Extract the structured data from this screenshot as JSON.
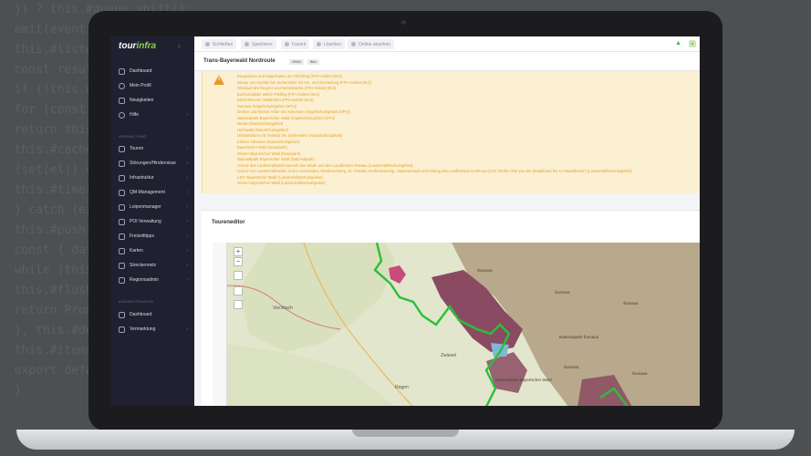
{
  "sidebar": {
    "logo_prefix": "tour",
    "logo_suffix": "infra",
    "items_top": [
      {
        "label": "Dashboard"
      },
      {
        "label": "Mein Profil"
      },
      {
        "label": "Neuigkeiten"
      },
      {
        "label": "Hilfe"
      }
    ],
    "section_verwaltung": "VERWALTUNG",
    "items_verwaltung": [
      {
        "label": "Touren"
      },
      {
        "label": "Störungen/Hindernisse"
      },
      {
        "label": "Infrastruktur"
      },
      {
        "label": "QM-Management"
      },
      {
        "label": "Loipenmanager"
      },
      {
        "label": "POI Verwaltung"
      },
      {
        "label": "Freizeittipps"
      },
      {
        "label": "Karten"
      },
      {
        "label": "Streckennetz"
      },
      {
        "label": "Regionsadmin"
      }
    ],
    "section_admin": "ADMINISTRATION",
    "items_admin": [
      {
        "label": "Dashboard"
      },
      {
        "label": "Vermarktung"
      }
    ]
  },
  "toolbar": {
    "close": "Schließen",
    "save": "Speichern",
    "favorite": "Favorit",
    "delete": "Löschen",
    "view_online": "Online ansehen"
  },
  "page": {
    "title": "Trans-Bayerwald Nordroute",
    "badge_id": "25963",
    "badge_type": "Bike"
  },
  "warning_lines": [
    "Bergwiesen und Magerrasen am Ohreberg (FFH-Gebiet (EU))",
    "Donau von Kachlet bis Jochenstein mit Inn- und Ilzmündung (FFH-Gebiet (EU))",
    "Oberlauf des Regens und Nebenbäche (FFH-Gebiet (EU))",
    "Buchenwälder östlich Pfelling (FFH-Gebiet (EU))",
    "Bischofsreuter Waldhufen (FFH-Gebiet (EU))",
    "Sumava (Vogelschutzgebiet (SPA))",
    "Großer und Kleiner Arber mit Arberseen (Vogelschutzgebiet (SPA))",
    "Nationalpark Bayerischer Wald (Vogelschutzgebiet (SPA))",
    "Mesau (Naturschutzgebiet)",
    "Hochwald (Naturschutzgebiet)",
    "Ohrwaldeben mit Trebnitz bis Jachenstein (Naturschutzgebiet)",
    "Kleiner Arbersee (Naturschutzgebiet)",
    "Bayerischer Wald (Naturpark)",
    "Oberer Bayerischer Wald (Naturpark)",
    "Nationalpark Bayerischer Wald (Nationalpark)",
    "Schutz des Landschaftsteils Bereich des Stadt- und des Landkreises Passau (Landschaftsschutzgebiet)",
    "Schutz von Landschaftsteilen in den Gemeinden Oberkreuzberg, St. Oswald, Grafenmaschig, Hammanstadt und Sirbing des Landkreises Grafenau (LSG 'Große Ohe von der Staatsforen bis zu Staatsforste') (Landschaftsschutzgebiet)",
    "LSG 'Bayerischer Wald' (Landschaftsschutzgebiet)",
    "Oberer Bayerischer Wald (Landschaftsschutzgebiet)"
  ],
  "editor": {
    "title": "Toureneditor",
    "zoom_in": "+",
    "zoom_out": "−"
  },
  "map_labels": [
    "Viechtach",
    "Zwiesel",
    "Regen",
    "Šumava",
    "Šumava",
    "Šumava",
    "Šumava",
    "Šumava",
    "Nationalpark Šumava",
    "Nationalpark Bayerischer Wald"
  ],
  "colors": {
    "sidebar": "#1f2130",
    "brand_green": "#8fd14f",
    "warning_bg": "#fcf0d3",
    "warning_text": "#e3a02a",
    "route": "#2bbf3a",
    "protected_area": "#8a4b62"
  }
}
